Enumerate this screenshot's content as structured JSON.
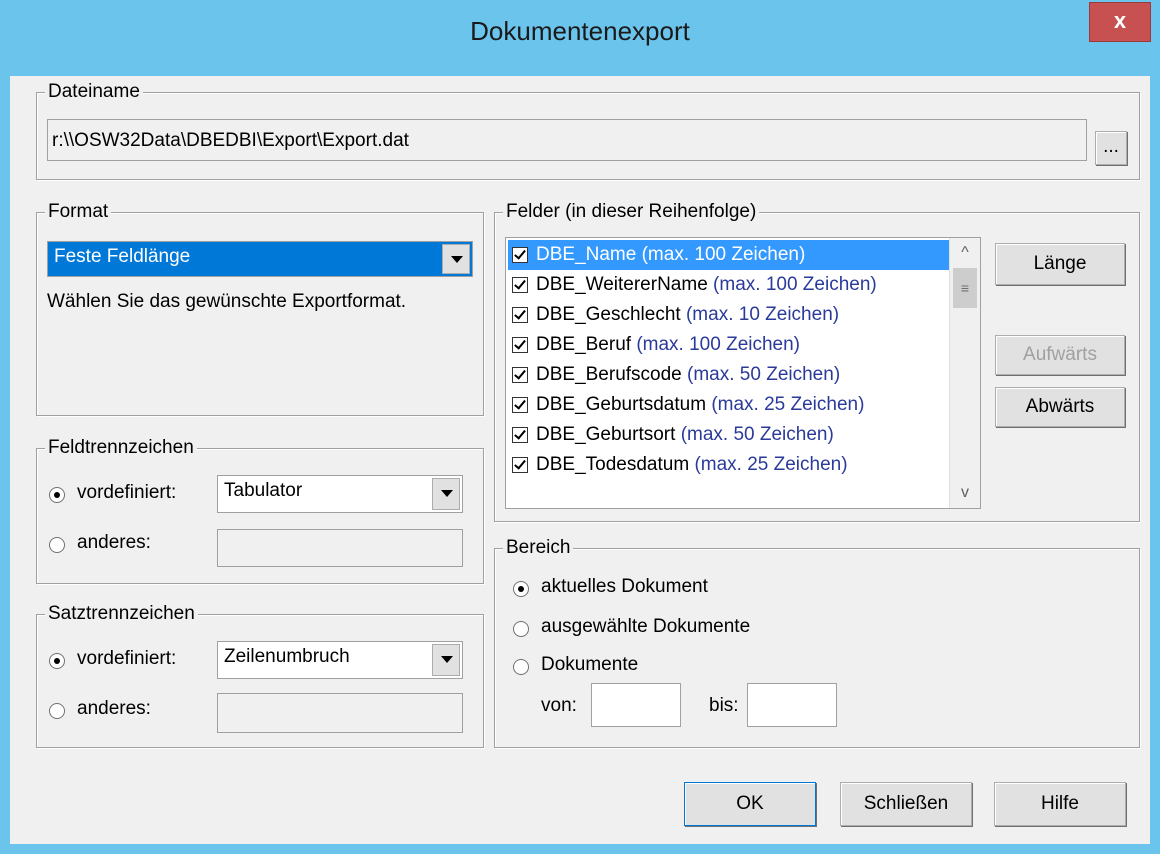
{
  "window": {
    "title": "Dokumentenexport",
    "close_label": "x"
  },
  "dateiname": {
    "legend": "Dateiname",
    "value": "r:\\\\OSW32Data\\DBEDBI\\Export\\Export.dat",
    "browse_label": "..."
  },
  "format": {
    "legend": "Format",
    "selected": "Feste Feldlänge",
    "hint": "Wählen Sie das gewünschte Exportformat."
  },
  "feldtrenn": {
    "legend": "Feldtrennzeichen",
    "predefined_label": "vordefiniert:",
    "predefined_value": "Tabulator",
    "other_label": "anderes:",
    "other_value": ""
  },
  "satztrenn": {
    "legend": "Satztrennzeichen",
    "predefined_label": "vordefiniert:",
    "predefined_value": "Zeilenumbruch",
    "other_label": "anderes:",
    "other_value": ""
  },
  "felder": {
    "legend": "Felder (in dieser Reihenfolge)",
    "items": [
      {
        "name": "DBE_Name",
        "max": "(max. 100 Zeichen)",
        "checked": true,
        "selected": true
      },
      {
        "name": "DBE_WeitererName",
        "max": "(max. 100 Zeichen)",
        "checked": true
      },
      {
        "name": "DBE_Geschlecht",
        "max": "(max. 10 Zeichen)",
        "checked": true
      },
      {
        "name": "DBE_Beruf",
        "max": "(max. 100 Zeichen)",
        "checked": true
      },
      {
        "name": "DBE_Berufscode",
        "max": "(max. 50 Zeichen)",
        "checked": true
      },
      {
        "name": "DBE_Geburtsdatum",
        "max": "(max. 25 Zeichen)",
        "checked": true
      },
      {
        "name": "DBE_Geburtsort",
        "max": "(max. 50 Zeichen)",
        "checked": true
      },
      {
        "name": "DBE_Todesdatum",
        "max": "(max. 25 Zeichen)",
        "checked": true
      }
    ],
    "laenge_label": "Länge",
    "aufwaerts_label": "Aufwärts",
    "abwaerts_label": "Abwärts"
  },
  "bereich": {
    "legend": "Bereich",
    "opt_current": "aktuelles Dokument",
    "opt_selected": "ausgewählte Dokumente",
    "opt_range": "Dokumente",
    "von_label": "von:",
    "bis_label": "bis:",
    "von_value": "",
    "bis_value": ""
  },
  "buttons": {
    "ok": "OK",
    "close": "Schließen",
    "help": "Hilfe"
  }
}
